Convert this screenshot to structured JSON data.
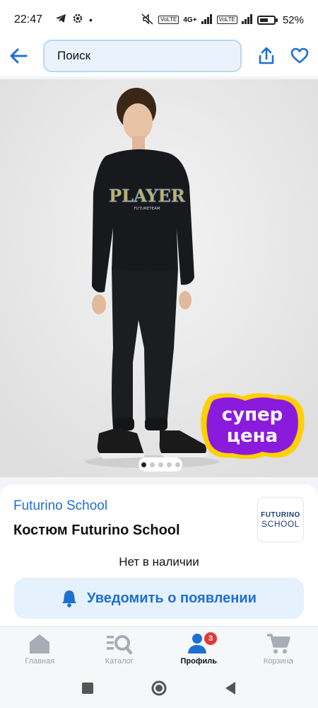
{
  "status_bar": {
    "time": "22:47",
    "network": "4G+",
    "battery_percent": "52%",
    "lte_label": "Vo LTE"
  },
  "top_bar": {
    "search_placeholder": "Поиск",
    "back_icon": "back-arrow-icon",
    "share_icon": "share-icon",
    "favorite_icon": "heart-icon"
  },
  "gallery": {
    "promo_line1": "супер",
    "promo_line2": "цена",
    "print_text": "PLAYER",
    "print_subtext": "FUTURETEAM",
    "image_count": 5,
    "active_index": 0
  },
  "product": {
    "brand": "Futurino School",
    "title": "Костюм Futurino School",
    "brand_logo_line1": "FUTURINO",
    "brand_logo_line2": "SCHOOL",
    "availability": "Нет в наличии",
    "notify_label": "Уведомить о появлении"
  },
  "bottom_nav": {
    "items": [
      {
        "label": "Главная",
        "icon": "home-icon"
      },
      {
        "label": "Каталог",
        "icon": "catalog-search-icon"
      },
      {
        "label": "Профиль",
        "icon": "profile-icon",
        "badge": "3"
      },
      {
        "label": "Корзина",
        "icon": "cart-icon"
      }
    ],
    "active_index": 2
  },
  "colors": {
    "accent": "#1f6fd1",
    "search_bg": "#eaf3fc",
    "promo_purple": "#8a1bdc",
    "promo_yellow": "#ffd000",
    "badge_red": "#e53935"
  }
}
